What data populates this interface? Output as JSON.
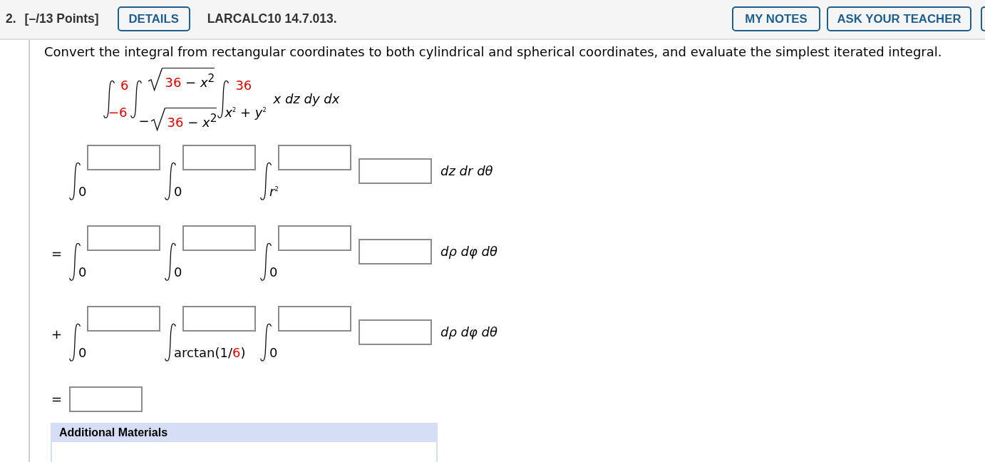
{
  "header": {
    "number": "2.",
    "points": "[–/13 Points]",
    "details_button": "DETAILS",
    "problem_code": "LARCALC10 14.7.013.",
    "buttons": [
      "MY NOTES",
      "ASK YOUR TEACHER"
    ]
  },
  "question": {
    "prompt": "Convert the integral from rectangular coordinates to both cylindrical and spherical coordinates, and evaluate the simplest iterated integral.",
    "given": {
      "integrals": [
        {
          "upper": {
            "kind": "text",
            "parts": [
              {
                "text": "6",
                "highlighted": true
              }
            ]
          },
          "lower": {
            "kind": "text",
            "parts": [
              {
                "text": "−6",
                "highlighted": true
              }
            ]
          }
        },
        {
          "upper": {
            "kind": "radical",
            "parts": [
              {
                "text": "36",
                "highlighted": true
              },
              {
                "text": " − *x*$^{2}$",
                "highlighted": false
              }
            ]
          },
          "lower": {
            "kind": "radical",
            "sign": "−",
            "parts": [
              {
                "text": "36",
                "highlighted": true
              },
              {
                "text": " − *x*$^{2}$",
                "highlighted": false
              }
            ]
          }
        },
        {
          "upper": {
            "kind": "text",
            "parts": [
              {
                "text": "36",
                "highlighted": true
              }
            ]
          },
          "lower": {
            "kind": "text",
            "parts": [
              {
                "text": "*x*$^{2}$ + *y*$^{2}$",
                "highlighted": false
              }
            ]
          }
        }
      ],
      "differentials": "x dz dy dx"
    },
    "rows": [
      {
        "integrals": [
          {
            "upper": {
              "kind": "input"
            },
            "lower": {
              "kind": "text",
              "parts": [
                {
                  "text": "0",
                  "highlighted": false
                }
              ]
            }
          },
          {
            "upper": {
              "kind": "input"
            },
            "lower": {
              "kind": "text",
              "parts": [
                {
                  "text": "0",
                  "highlighted": false
                }
              ]
            }
          },
          {
            "upper": {
              "kind": "input"
            },
            "lower": {
              "kind": "text",
              "parts": [
                {
                  "text": "*r*$^{2}$",
                  "highlighted": false
                }
              ]
            }
          }
        ],
        "integrand": {
          "kind": "input"
        },
        "differentials": "dz dr dθ"
      },
      {
        "operator": "=",
        "integrals": [
          {
            "upper": {
              "kind": "input"
            },
            "lower": {
              "kind": "text",
              "parts": [
                {
                  "text": "0",
                  "highlighted": false
                }
              ]
            }
          },
          {
            "upper": {
              "kind": "input"
            },
            "lower": {
              "kind": "text",
              "parts": [
                {
                  "text": "0",
                  "highlighted": false
                }
              ]
            }
          },
          {
            "upper": {
              "kind": "input"
            },
            "lower": {
              "kind": "text",
              "parts": [
                {
                  "text": "0",
                  "highlighted": false
                }
              ]
            }
          }
        ],
        "integrand": {
          "kind": "input"
        },
        "differentials": "dρ dφ dθ"
      },
      {
        "operator": "+",
        "integrals": [
          {
            "upper": {
              "kind": "input"
            },
            "lower": {
              "kind": "text",
              "parts": [
                {
                  "text": "0",
                  "highlighted": false
                }
              ]
            }
          },
          {
            "upper": {
              "kind": "input"
            },
            "lower": {
              "kind": "text",
              "parts": [
                {
                  "text": "arctan(1/",
                  "highlighted": false
                },
                {
                  "text": "6",
                  "highlighted": true
                },
                {
                  "text": ")",
                  "highlighted": false
                }
              ]
            }
          },
          {
            "upper": {
              "kind": "input"
            },
            "lower": {
              "kind": "text",
              "parts": [
                {
                  "text": "0",
                  "highlighted": false
                }
              ]
            }
          }
        ],
        "integrand": {
          "kind": "input"
        },
        "differentials": "dρ dφ dθ"
      }
    ],
    "result": {
      "operator": "=",
      "field": {
        "kind": "input"
      }
    }
  },
  "additional_materials": {
    "title": "Additional Materials"
  }
}
